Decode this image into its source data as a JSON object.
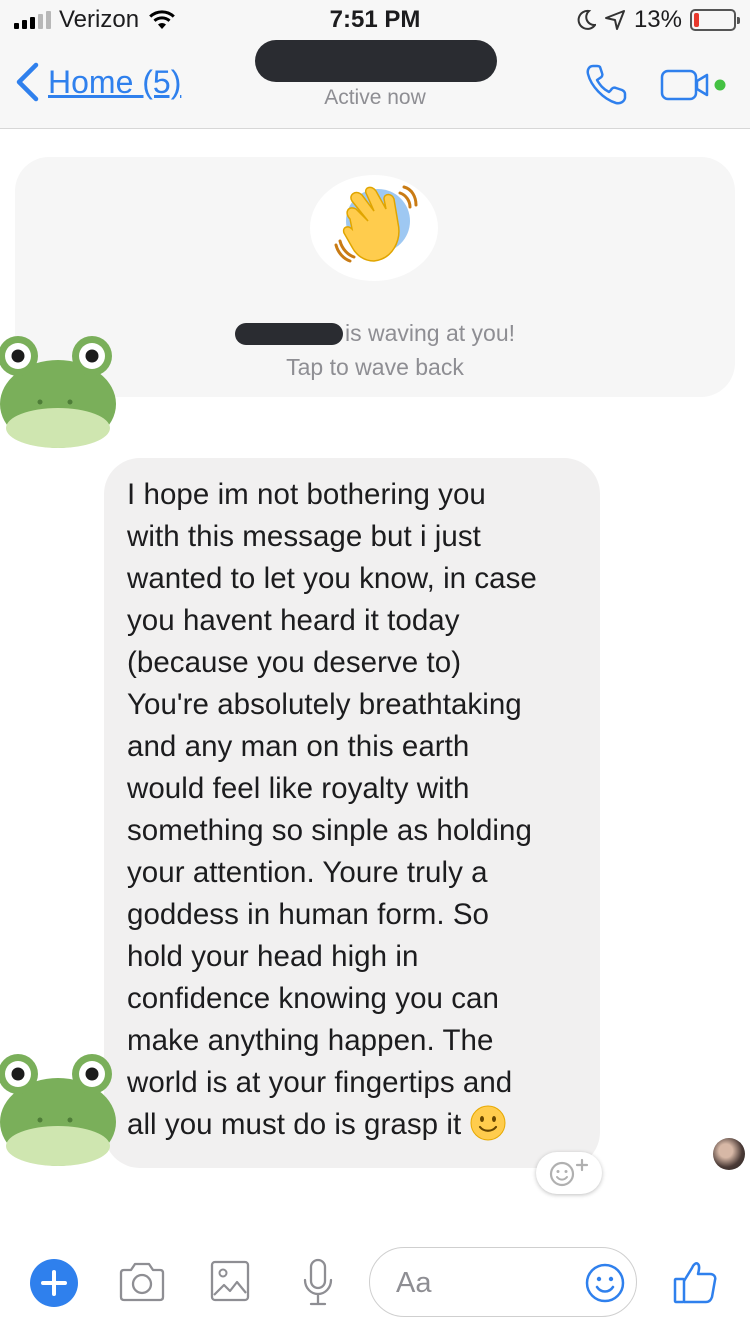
{
  "status_bar": {
    "carrier": "Verizon",
    "time": "7:51 PM",
    "battery_percent": "13%",
    "battery_level": 0.13,
    "signal_bars": 3,
    "signal_total": 5,
    "icons": [
      "signal-icon",
      "wifi-icon",
      "moon-icon",
      "location-arrow-icon",
      "battery-icon"
    ]
  },
  "header": {
    "back_label": "Home (5)",
    "status": "Active now",
    "icons": [
      "chevron-left-icon",
      "phone-icon",
      "video-camera-icon"
    ],
    "colors": {
      "accent": "#2f80ed",
      "online": "#44c142"
    }
  },
  "wave_card": {
    "line1": "is waving at you!",
    "line2": "Tap to wave back",
    "icon": "waving-hand-icon"
  },
  "message": {
    "text": "I hope im not bothering you\nwith this message but i just\nwanted to let you know, in case\nyou havent heard it today\n(because you deserve to)\nYou're absolutely breathtaking\nand any man on this earth\nwould feel like royalty with\nsomething so sinple as holding\nyour attention. Youre truly a\ngoddess in human form. So\nhold your head high in\nconfidence knowing you can\nmake anything happen. The\nworld is at your fingertips and\nall you must do is grasp it",
    "trailing_emoji": "slightly-smiling-face-icon",
    "reaction_icon": "add-reaction-icon"
  },
  "composer": {
    "placeholder": "Aa",
    "icons": [
      "plus-icon",
      "camera-icon",
      "image-icon",
      "microphone-icon",
      "emoji-icon",
      "thumbs-up-icon"
    ]
  },
  "colors": {
    "bubble": "#f1f0f0",
    "card": "#f6f6f6",
    "redaction": "#2a2c31",
    "frog": "#7aaf5a"
  }
}
